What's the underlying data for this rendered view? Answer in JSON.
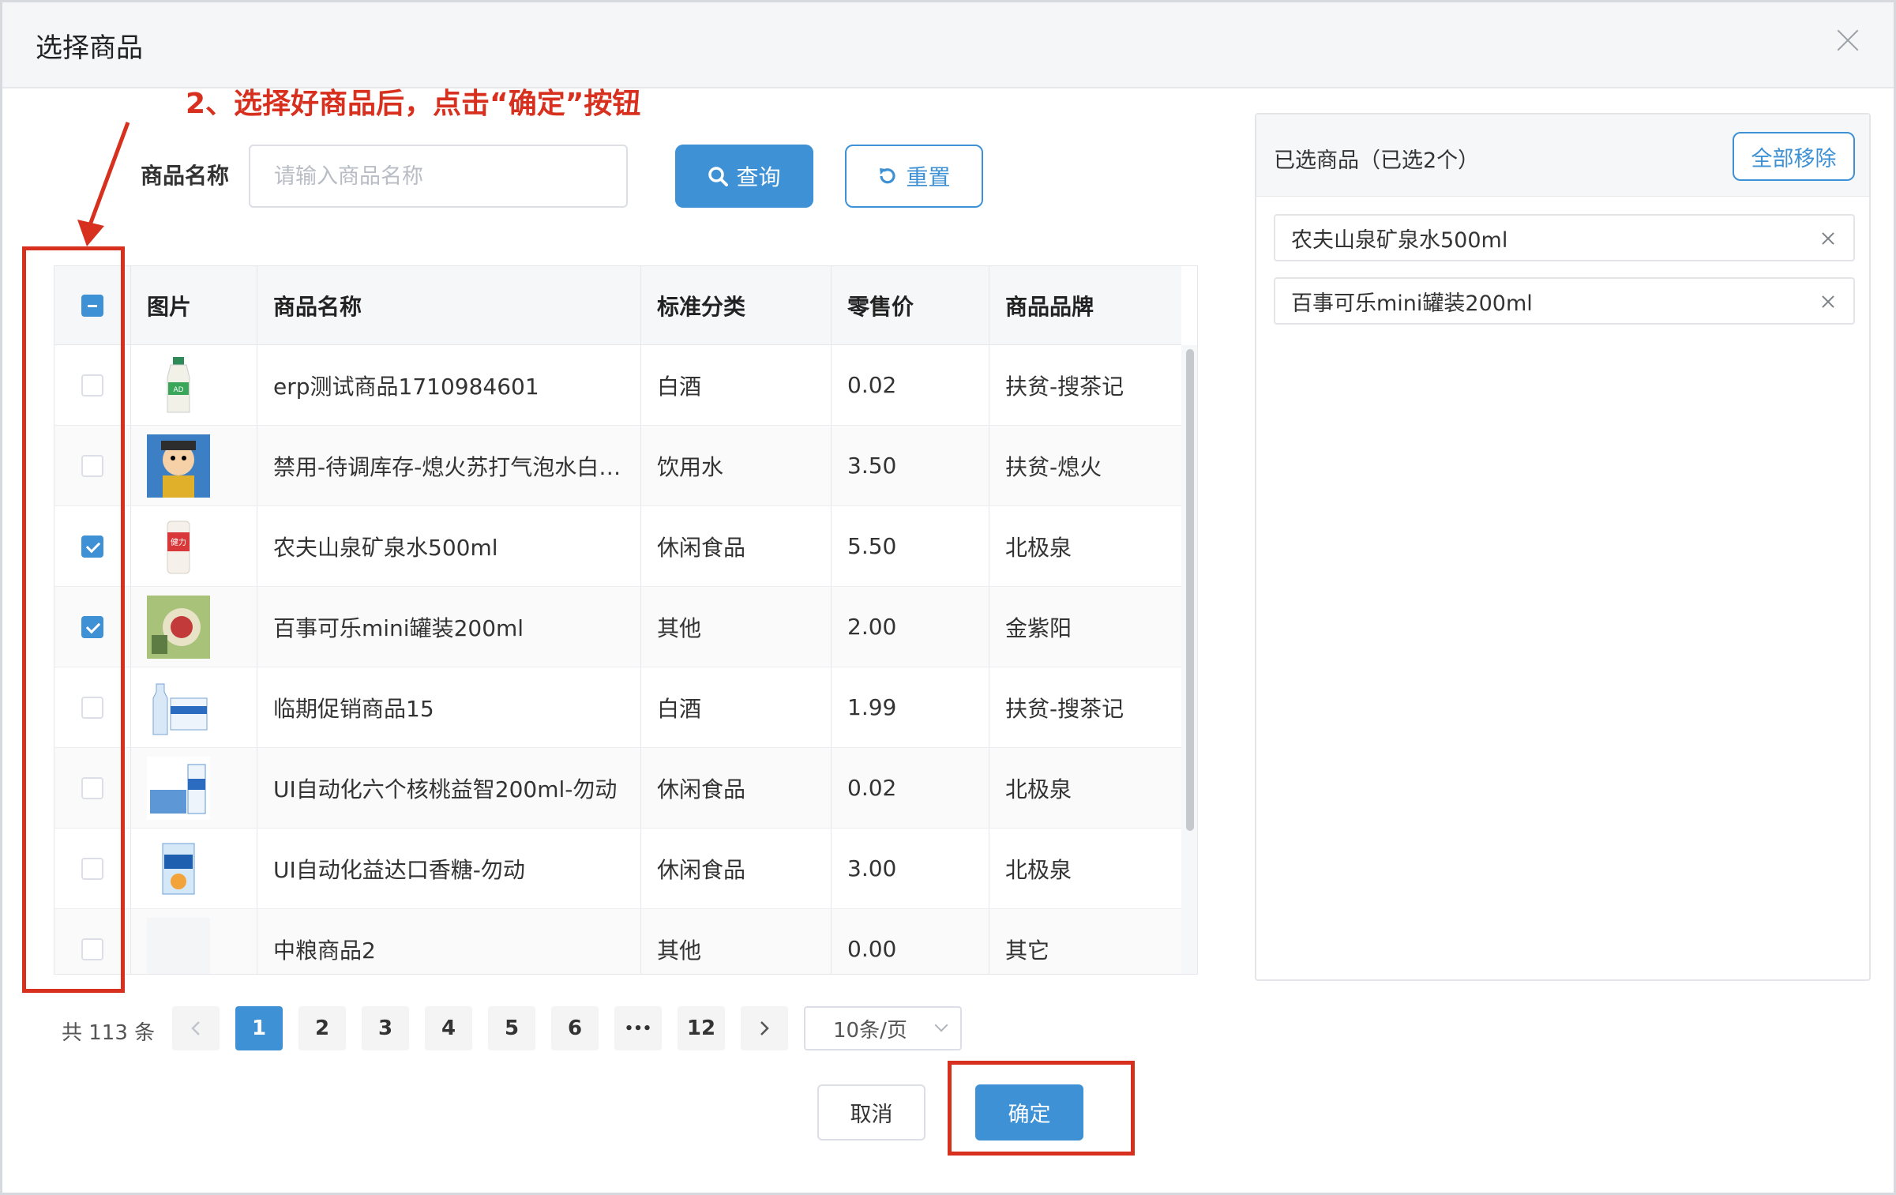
{
  "dialog": {
    "title": "选择商品"
  },
  "annotation": {
    "text": "2、选择好商品后，点击“确定”按钮"
  },
  "search": {
    "label": "商品名称",
    "placeholder": "请输入商品名称",
    "query_label": "查询",
    "reset_label": "重置"
  },
  "table": {
    "columns": [
      "图片",
      "商品名称",
      "标准分类",
      "零售价",
      "商品品牌"
    ],
    "rows": [
      {
        "name": "erp测试商品1710984601",
        "category": "白酒",
        "price": "0.02",
        "brand": "扶贫-搜茶记",
        "checked": false,
        "thumb": "bottle-drink-icon"
      },
      {
        "name": "禁用-待调库存-熄火苏打气泡水白桃味",
        "category": "饮用水",
        "price": "3.50",
        "brand": "扶贫-熄火",
        "checked": false,
        "thumb": "cartoon-image"
      },
      {
        "name": "农夫山泉矿泉水500ml",
        "category": "休闲食品",
        "price": "5.50",
        "brand": "北极泉",
        "checked": true,
        "thumb": "can-drink-icon"
      },
      {
        "name": "百事可乐mini罐装200ml",
        "category": "其他",
        "price": "2.00",
        "brand": "金紫阳",
        "checked": true,
        "thumb": "product-photo"
      },
      {
        "name": "临期促销商品15",
        "category": "白酒",
        "price": "1.99",
        "brand": "扶贫-搜茶记",
        "checked": false,
        "thumb": "water-box-icon"
      },
      {
        "name": "UI自动化六个核桃益智200ml-勿动",
        "category": "休闲食品",
        "price": "0.02",
        "brand": "北极泉",
        "checked": false,
        "thumb": "carton-pack-icon"
      },
      {
        "name": "UI自动化益达口香糖-勿动",
        "category": "休闲食品",
        "price": "3.00",
        "brand": "北极泉",
        "checked": false,
        "thumb": "snack-pack-icon"
      },
      {
        "name": "中粮商品2",
        "category": "其他",
        "price": "0.00",
        "brand": "其它",
        "checked": false,
        "thumb": "blank-image"
      }
    ]
  },
  "pagination": {
    "total_text": "共 113 条",
    "pages": [
      "1",
      "2",
      "3",
      "4",
      "5",
      "6",
      "•••",
      "12"
    ],
    "current": "1",
    "page_size": "10条/页"
  },
  "footer": {
    "cancel_label": "取消",
    "ok_label": "确定"
  },
  "selected_panel": {
    "title": "已选商品（已选2个）",
    "remove_all_label": "全部移除",
    "items": [
      "农夫山泉矿泉水500ml",
      "百事可乐mini罐装200ml"
    ]
  },
  "colors": {
    "primary": "#3e91d4",
    "annotation_red": "#d7301f"
  }
}
